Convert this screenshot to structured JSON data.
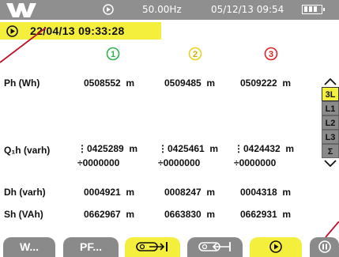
{
  "status_bar": {
    "record_icon": "record-icon",
    "frequency": "50.00Hz",
    "datetime": "05/12/13 09:54",
    "battery_icon": "battery-icon"
  },
  "hold": {
    "icon": "hold-play-icon",
    "timestamp": "22/04/13 09:33:28",
    "highlight_color": "#f4ee3d"
  },
  "phases": [
    {
      "label": "1",
      "color": "#2db34a"
    },
    {
      "label": "2",
      "color": "#e8d21a"
    },
    {
      "label": "3",
      "color": "#e02020"
    }
  ],
  "rows": [
    {
      "label": "Ph (Wh)",
      "values": [
        "0508552  m",
        "0509485  m",
        "0509222  m"
      ]
    },
    {
      "label": "Q₁h (varh)",
      "values": [
        "⋮0425289  m",
        "⋮0425461  m",
        "⋮0424432  m"
      ],
      "sub_values": [
        "÷0000000",
        "÷0000000",
        "÷0000000"
      ]
    },
    {
      "label": "Dh (varh)",
      "values": [
        "0004921  m",
        "0008247  m",
        "0004318  m"
      ]
    },
    {
      "label": "Sh (VAh)",
      "values": [
        "0662967  m",
        "0663830  m",
        "0662931  m"
      ]
    }
  ],
  "selector": {
    "items": [
      "3L",
      "L1",
      "L2",
      "L3",
      "Σ"
    ],
    "active": "3L"
  },
  "tabs": [
    {
      "label": "W..."
    },
    {
      "label": "PF..."
    },
    {
      "label": "",
      "icon": "export-icon"
    },
    {
      "label": "",
      "icon": "import-icon"
    },
    {
      "label": "",
      "icon": "play-icon"
    },
    {
      "label": "",
      "icon": "pause-icon"
    }
  ],
  "colors": {
    "status_bar": "#8f8f8f",
    "accent_yellow": "#f4ee3d",
    "pointer_red": "#c0102a"
  }
}
